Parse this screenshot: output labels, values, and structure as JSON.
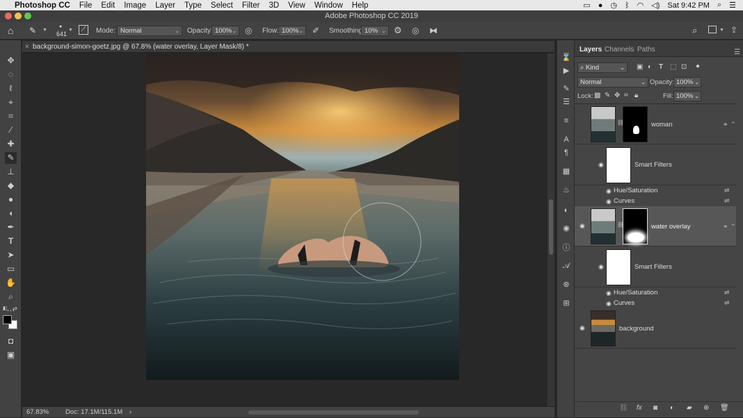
{
  "menubar": {
    "app": "Photoshop CC",
    "items": [
      "File",
      "Edit",
      "Image",
      "Layer",
      "Type",
      "Select",
      "Filter",
      "3D",
      "View",
      "Window",
      "Help"
    ],
    "clock": "Sat 9:42 PM"
  },
  "window": {
    "title": "Adobe Photoshop CC 2019"
  },
  "options": {
    "brush_size": "641",
    "mode_label": "Mode:",
    "mode_value": "Normal",
    "opacity_label": "Opacity:",
    "opacity_value": "100%",
    "flow_label": "Flow:",
    "flow_value": "100%",
    "smoothing_label": "Smoothing:",
    "smoothing_value": "10%"
  },
  "document": {
    "tab_title": "background-simon-goetz.jpg @ 67.8% (water overlay, Layer Mask/8) *",
    "close": "×"
  },
  "status": {
    "zoom": "67.83%",
    "doc_size": "Doc: 17.1M/115.1M",
    "arrow": "›"
  },
  "panel": {
    "tabs": [
      "Layers",
      "Channels",
      "Paths"
    ],
    "filter_kind": "Kind",
    "blend_mode": "Normal",
    "opacity_label": "Opacity:",
    "opacity_value": "100%",
    "lock_label": "Lock:",
    "fill_label": "Fill:",
    "fill_value": "100%"
  },
  "layers": [
    {
      "name": "woman",
      "smart_filters": "Smart Filters",
      "filters": [
        "Hue/Saturation",
        "Curves"
      ]
    },
    {
      "name": "water overlay",
      "smart_filters": "Smart Filters",
      "filters": [
        "Hue/Saturation",
        "Curves"
      ]
    },
    {
      "name": "background"
    }
  ],
  "colors": {
    "accent": "#4f4f4f",
    "selected_row": "#575757"
  }
}
